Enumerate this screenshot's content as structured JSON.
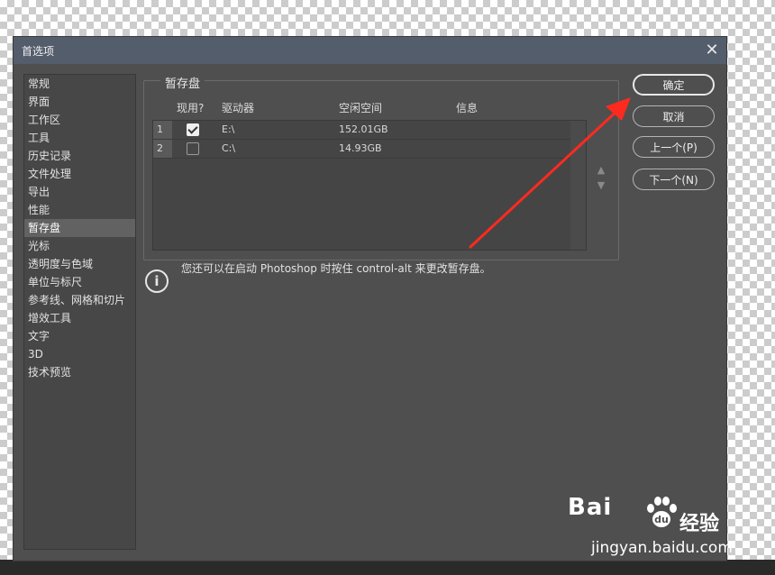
{
  "dialog": {
    "title": "首选项",
    "close_icon": "close-icon"
  },
  "sidebar": {
    "items": [
      {
        "label": "常规"
      },
      {
        "label": "界面"
      },
      {
        "label": "工作区"
      },
      {
        "label": "工具"
      },
      {
        "label": "历史记录"
      },
      {
        "label": "文件处理"
      },
      {
        "label": "导出"
      },
      {
        "label": "性能"
      },
      {
        "label": "暂存盘"
      },
      {
        "label": "光标"
      },
      {
        "label": "透明度与色域"
      },
      {
        "label": "单位与标尺"
      },
      {
        "label": "参考线、网格和切片"
      },
      {
        "label": "增效工具"
      },
      {
        "label": "文字"
      },
      {
        "label": "3D"
      },
      {
        "label": "技术预览"
      }
    ],
    "active_index": 8
  },
  "scratch": {
    "group_title": "暂存盘",
    "columns": {
      "active": "现用?",
      "drive": "驱动器",
      "free": "空闲空间",
      "info": "信息"
    },
    "rows": [
      {
        "num": "1",
        "checked": true,
        "drive": "E:\\",
        "free": "152.01GB",
        "info": ""
      },
      {
        "num": "2",
        "checked": false,
        "drive": "C:\\",
        "free": "14.93GB",
        "info": ""
      }
    ],
    "move_up_icon": "triangle-up-icon",
    "move_down_icon": "triangle-down-icon"
  },
  "info": {
    "icon": "info-icon",
    "text": "您还可以在启动 Photoshop 时按住 control-alt 来更改暂存盘。"
  },
  "buttons": {
    "ok": "确定",
    "cancel": "取消",
    "prev": "上一个(P)",
    "next": "下一个(N)"
  },
  "colors": {
    "titlebar": "#535d6b",
    "panel": "#4f4f4f",
    "annotation_arrow": "#ff2a1f"
  },
  "watermark": {
    "logo_text": "Bai",
    "brand": "经验",
    "url": "jingyan.baidu.com"
  }
}
